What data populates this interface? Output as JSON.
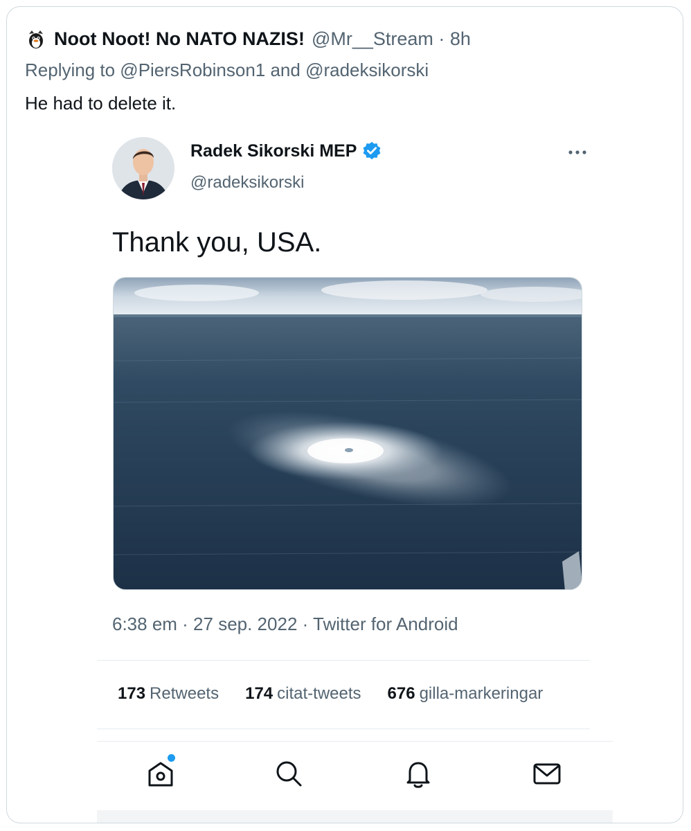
{
  "outer_tweet": {
    "author_name": "Noot Noot! No NATO NAZIS!",
    "handle_time": "@Mr__Stream · 8h",
    "reply_to": "Replying to @PiersRobinson1 and @radeksikorski",
    "text": "He had to delete it."
  },
  "embedded_tweet": {
    "author_name": "Radek Sikorski MEP",
    "handle": "@radeksikorski",
    "text": "Thank you, USA.",
    "meta": "6:38 em · 27 sep. 2022 · Twitter for Android",
    "stats": [
      {
        "count": "173",
        "label": "Retweets"
      },
      {
        "count": "174",
        "label": "citat-tweets"
      },
      {
        "count": "676",
        "label": "gilla-markeringar"
      }
    ]
  },
  "icons": {
    "verified": "verified-badge-icon",
    "more": "more-icon",
    "home": "home-icon",
    "search": "search-icon",
    "notifications": "bell-icon",
    "messages": "mail-icon"
  },
  "colors": {
    "accent": "#1d9bf0",
    "text_primary": "#0f1419",
    "text_secondary": "#536471",
    "border": "#cfd9de"
  }
}
